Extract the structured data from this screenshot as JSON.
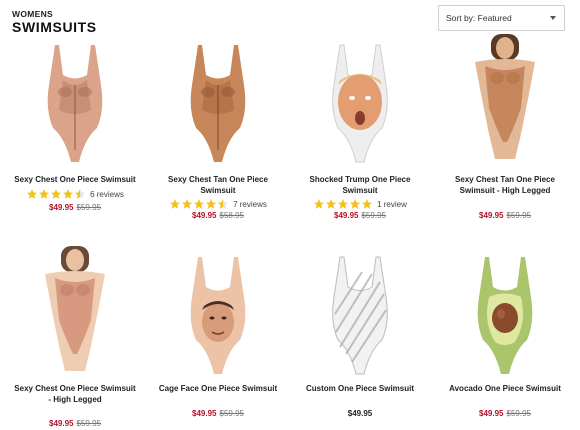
{
  "header": {
    "breadcrumb": "WOMENS",
    "title": "SWIMSUITS",
    "sort_label": "Sort by: Featured"
  },
  "products": [
    {
      "name": "Sexy Chest One Piece Swimsuit",
      "price": "$49.95",
      "was": "$59.95",
      "rating": 4.5,
      "reviews": "6 reviews",
      "image": "hairy-chest-swimsuit"
    },
    {
      "name": "Sexy Chest Tan One Piece Swimsuit",
      "price": "$49.95",
      "was": "$58.95",
      "rating": 4.5,
      "reviews": "7 reviews",
      "image": "tan-chest-swimsuit"
    },
    {
      "name": "Shocked Trump One Piece Swimsuit",
      "price": "$49.95",
      "was": "$59.95",
      "rating": 5,
      "reviews": "1 review",
      "image": "face-print-swimsuit"
    },
    {
      "name": "Sexy Chest Tan One Piece Swimsuit - High Legged",
      "price": "$49.95",
      "was": "$59.95",
      "image": "model-tan-swimsuit"
    },
    {
      "name": "Sexy Chest One Piece Swimsuit - High Legged",
      "price": "$49.95",
      "was": "$59.95",
      "image": "model-chest-swimsuit"
    },
    {
      "name": "Cage Face One Piece Swimsuit",
      "price": "$49.95",
      "was": "$59.95",
      "image": "face-print-swimsuit"
    },
    {
      "name": "Custom One Piece Swimsuit",
      "price": "$49.95",
      "was": "",
      "image": "custom-text-swimsuit"
    },
    {
      "name": "Avocado One Piece Swimsuit",
      "price": "$49.95",
      "was": "$59.95",
      "image": "avocado-swimsuit"
    }
  ],
  "colors": {
    "sale": "#b3122a",
    "star": "#f2c21b",
    "skin": "#d9a07c",
    "skin_tan": "#c98a5a",
    "avocado": "#a7c265"
  }
}
